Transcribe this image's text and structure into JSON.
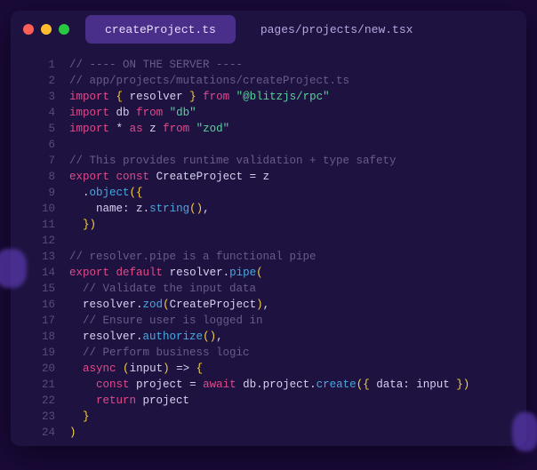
{
  "colors": {
    "red": "#ff5f57",
    "yellow": "#febc2e",
    "green": "#28c840",
    "blob": "#5a3ab0"
  },
  "tabs": [
    {
      "label": "createProject.ts",
      "active": true
    },
    {
      "label": "pages/projects/new.tsx",
      "active": false
    }
  ],
  "line_numbers": [
    "1",
    "2",
    "3",
    "4",
    "5",
    "6",
    "7",
    "8",
    "9",
    "10",
    "11",
    "12",
    "13",
    "14",
    "15",
    "16",
    "17",
    "18",
    "19",
    "20",
    "21",
    "22",
    "23",
    "24"
  ],
  "code": [
    [
      [
        "comment",
        "// ---- ON THE SERVER ----"
      ]
    ],
    [
      [
        "comment",
        "// app/projects/mutations/createProject.ts"
      ]
    ],
    [
      [
        "keyword",
        "import"
      ],
      [
        "punc",
        " "
      ],
      [
        "brace",
        "{"
      ],
      [
        "punc",
        " "
      ],
      [
        "ident",
        "resolver"
      ],
      [
        "punc",
        " "
      ],
      [
        "brace",
        "}"
      ],
      [
        "punc",
        " "
      ],
      [
        "keyword",
        "from"
      ],
      [
        "punc",
        " "
      ],
      [
        "string",
        "\"@blitzjs/rpc\""
      ]
    ],
    [
      [
        "keyword",
        "import"
      ],
      [
        "punc",
        " "
      ],
      [
        "ident",
        "db"
      ],
      [
        "punc",
        " "
      ],
      [
        "keyword",
        "from"
      ],
      [
        "punc",
        " "
      ],
      [
        "string",
        "\"db\""
      ]
    ],
    [
      [
        "keyword",
        "import"
      ],
      [
        "punc",
        " "
      ],
      [
        "ident",
        "*"
      ],
      [
        "punc",
        " "
      ],
      [
        "keyword",
        "as"
      ],
      [
        "punc",
        " "
      ],
      [
        "ident",
        "z"
      ],
      [
        "punc",
        " "
      ],
      [
        "keyword",
        "from"
      ],
      [
        "punc",
        " "
      ],
      [
        "string",
        "\"zod\""
      ]
    ],
    [],
    [
      [
        "comment",
        "// This provides runtime validation + type safety"
      ]
    ],
    [
      [
        "export",
        "export"
      ],
      [
        "punc",
        " "
      ],
      [
        "keyword",
        "const"
      ],
      [
        "punc",
        " "
      ],
      [
        "type",
        "CreateProject"
      ],
      [
        "punc",
        " = "
      ],
      [
        "ident",
        "z"
      ]
    ],
    [
      [
        "punc",
        "  ."
      ],
      [
        "func",
        "object"
      ],
      [
        "brace",
        "("
      ],
      [
        "brace",
        "{"
      ]
    ],
    [
      [
        "punc",
        "    "
      ],
      [
        "prop",
        "name"
      ],
      [
        "punc",
        ": "
      ],
      [
        "ident",
        "z"
      ],
      [
        "punc",
        "."
      ],
      [
        "func",
        "string"
      ],
      [
        "brace",
        "()"
      ],
      [
        "punc",
        ","
      ]
    ],
    [
      [
        "punc",
        "  "
      ],
      [
        "brace",
        "})"
      ]
    ],
    [],
    [
      [
        "comment",
        "// resolver.pipe is a functional pipe"
      ]
    ],
    [
      [
        "export",
        "export"
      ],
      [
        "punc",
        " "
      ],
      [
        "keyword",
        "default"
      ],
      [
        "punc",
        " "
      ],
      [
        "ident",
        "resolver"
      ],
      [
        "punc",
        "."
      ],
      [
        "func",
        "pipe"
      ],
      [
        "brace",
        "("
      ]
    ],
    [
      [
        "punc",
        "  "
      ],
      [
        "comment",
        "// Validate the input data"
      ]
    ],
    [
      [
        "punc",
        "  "
      ],
      [
        "ident",
        "resolver"
      ],
      [
        "punc",
        "."
      ],
      [
        "func",
        "zod"
      ],
      [
        "brace",
        "("
      ],
      [
        "type",
        "CreateProject"
      ],
      [
        "brace",
        ")"
      ],
      [
        "punc",
        ","
      ]
    ],
    [
      [
        "punc",
        "  "
      ],
      [
        "comment",
        "// Ensure user is logged in"
      ]
    ],
    [
      [
        "punc",
        "  "
      ],
      [
        "ident",
        "resolver"
      ],
      [
        "punc",
        "."
      ],
      [
        "func",
        "authorize"
      ],
      [
        "brace",
        "()"
      ],
      [
        "punc",
        ","
      ]
    ],
    [
      [
        "punc",
        "  "
      ],
      [
        "comment",
        "// Perform business logic"
      ]
    ],
    [
      [
        "punc",
        "  "
      ],
      [
        "keyword",
        "async"
      ],
      [
        "punc",
        " "
      ],
      [
        "brace",
        "("
      ],
      [
        "prop",
        "input"
      ],
      [
        "brace",
        ")"
      ],
      [
        "punc",
        " => "
      ],
      [
        "brace",
        "{"
      ]
    ],
    [
      [
        "punc",
        "    "
      ],
      [
        "keyword",
        "const"
      ],
      [
        "punc",
        " "
      ],
      [
        "ident",
        "project"
      ],
      [
        "punc",
        " = "
      ],
      [
        "keyword",
        "await"
      ],
      [
        "punc",
        " "
      ],
      [
        "ident",
        "db"
      ],
      [
        "punc",
        "."
      ],
      [
        "prop",
        "project"
      ],
      [
        "punc",
        "."
      ],
      [
        "func",
        "create"
      ],
      [
        "brace",
        "({"
      ],
      [
        "punc",
        " "
      ],
      [
        "prop",
        "data"
      ],
      [
        "punc",
        ": "
      ],
      [
        "prop",
        "input"
      ],
      [
        "punc",
        " "
      ],
      [
        "brace",
        "})"
      ]
    ],
    [
      [
        "punc",
        "    "
      ],
      [
        "return",
        "return"
      ],
      [
        "punc",
        " "
      ],
      [
        "ident",
        "project"
      ]
    ],
    [
      [
        "punc",
        "  "
      ],
      [
        "brace",
        "}"
      ]
    ],
    [
      [
        "brace",
        ")"
      ]
    ]
  ]
}
